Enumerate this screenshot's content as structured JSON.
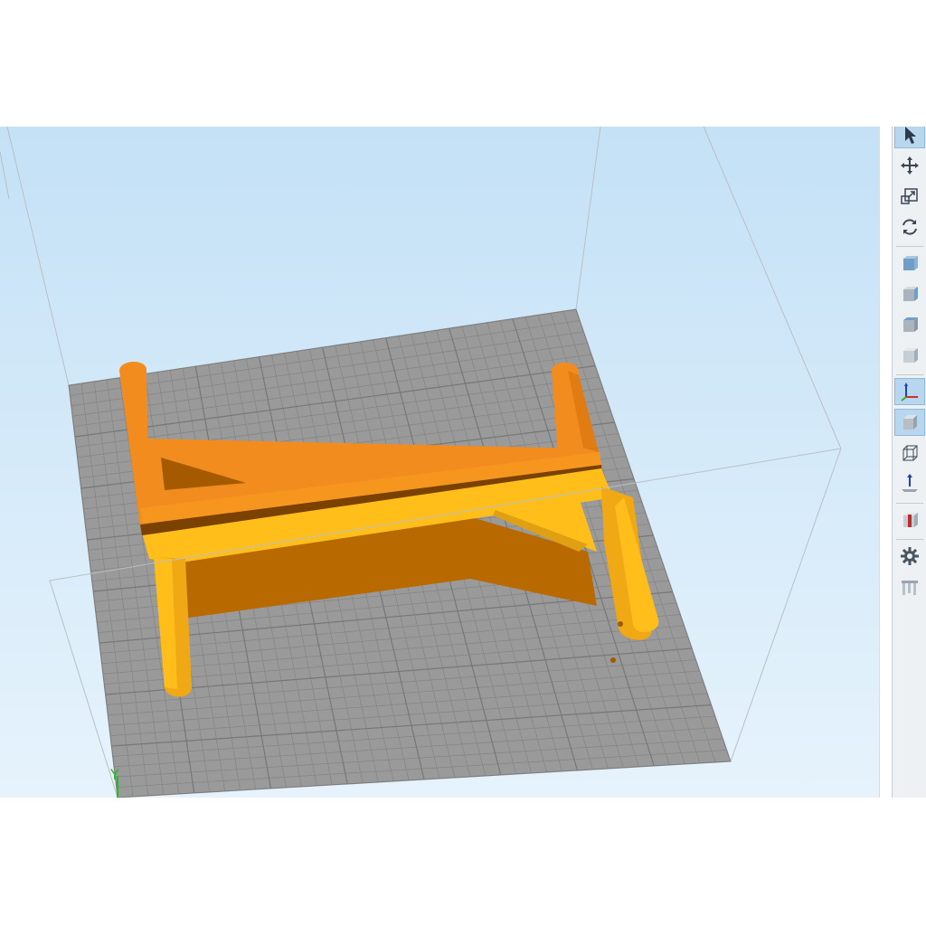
{
  "window": {
    "toolbar": {
      "groups": [
        [
          {
            "name": "select-tool",
            "icon": "pointer-icon",
            "active": true
          },
          {
            "name": "move-tool",
            "icon": "move-arrows-icon",
            "active": false
          },
          {
            "name": "scale-tool",
            "icon": "scale-icon",
            "active": false
          },
          {
            "name": "rotate-tool",
            "icon": "rotate-icon",
            "active": false
          }
        ],
        [
          {
            "name": "view-front",
            "icon": "cube-front-icon",
            "active": false
          },
          {
            "name": "view-side",
            "icon": "cube-side-icon",
            "active": false
          },
          {
            "name": "view-top",
            "icon": "cube-top-icon",
            "active": false
          },
          {
            "name": "view-iso",
            "icon": "cube-iso-icon",
            "active": false
          }
        ],
        [
          {
            "name": "toggle-axes",
            "icon": "axes-icon",
            "active": true
          },
          {
            "name": "solid-view",
            "icon": "solid-cube-icon",
            "active": true
          },
          {
            "name": "wireframe-view",
            "icon": "wireframe-cube-icon",
            "active": false
          },
          {
            "name": "place-on-bed",
            "icon": "drop-to-bed-icon",
            "active": false
          }
        ],
        [
          {
            "name": "cross-section",
            "icon": "cross-section-icon",
            "active": false
          }
        ],
        [
          {
            "name": "settings",
            "icon": "gear-icon",
            "active": false
          },
          {
            "name": "supports",
            "icon": "supports-icon",
            "active": false
          }
        ]
      ]
    },
    "colors": {
      "sky_top": "#c4e1f6",
      "sky_bottom": "#e6f3fc",
      "bed": "#9a9a9a",
      "model_dark": "#f28c1e",
      "model_light": "#ffbe1a",
      "model_shadow": "#b86a00",
      "accent": "#8fb8dc"
    },
    "axis_label": "Y"
  }
}
